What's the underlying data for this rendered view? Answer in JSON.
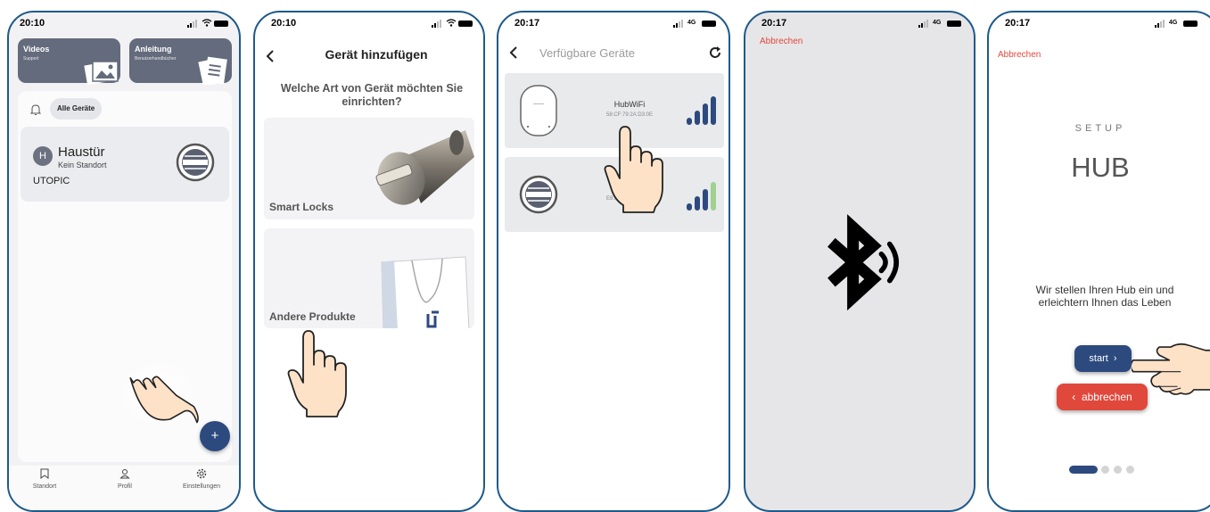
{
  "screen1": {
    "time": "20:10",
    "tile_videos": {
      "title": "Videos",
      "subtitle": "Support"
    },
    "tile_manual": {
      "title": "Anleitung",
      "subtitle": "Benutzerhandbücher"
    },
    "filter_chip": "Alle Geräte",
    "device": {
      "avatar_letter": "H",
      "name": "Haustür",
      "location": "Kein Standort",
      "brand": "UTOPIC"
    },
    "fab_label": "+",
    "nav": [
      {
        "label": "Standort",
        "icon": "bookmark-icon"
      },
      {
        "label": "Profil",
        "icon": "person-icon"
      },
      {
        "label": "Einstellungen",
        "icon": "gear-icon"
      }
    ]
  },
  "screen2": {
    "time": "20:10",
    "title": "Gerät hinzufügen",
    "question": "Welche Art von Gerät möchten Sie einrichten?",
    "cards": [
      {
        "label": "Smart Locks"
      },
      {
        "label": "Andere Produkte"
      }
    ]
  },
  "screen3": {
    "time": "20:17",
    "network": "4G",
    "title": "Verfügbare Geräte",
    "devices": [
      {
        "name": "HubWiFi",
        "mac": "58:CF:79:2A:D3:0E"
      },
      {
        "name": "U",
        "mac": "E8:FC:32:8B:D5:60"
      }
    ]
  },
  "screen4": {
    "time": "20:17",
    "network": "4G",
    "cancel": "Abbrechen"
  },
  "screen5": {
    "time": "20:17",
    "network": "4G",
    "cancel": "Abbrechen",
    "setup_label": "SETUP",
    "title": "HUB",
    "description": "Wir stellen Ihren Hub ein und erleichtern Ihnen das Leben",
    "start_button": "start  ›",
    "abort_button": "‹  abbrechen",
    "pages": 4,
    "active_page": 1
  },
  "colors": {
    "frame": "#1f5a8a",
    "navy": "#2d4a7f",
    "tile": "#636b7c",
    "red": "#e0483c",
    "signal_green": "#9fd18f",
    "skin": "#fde2c8"
  }
}
